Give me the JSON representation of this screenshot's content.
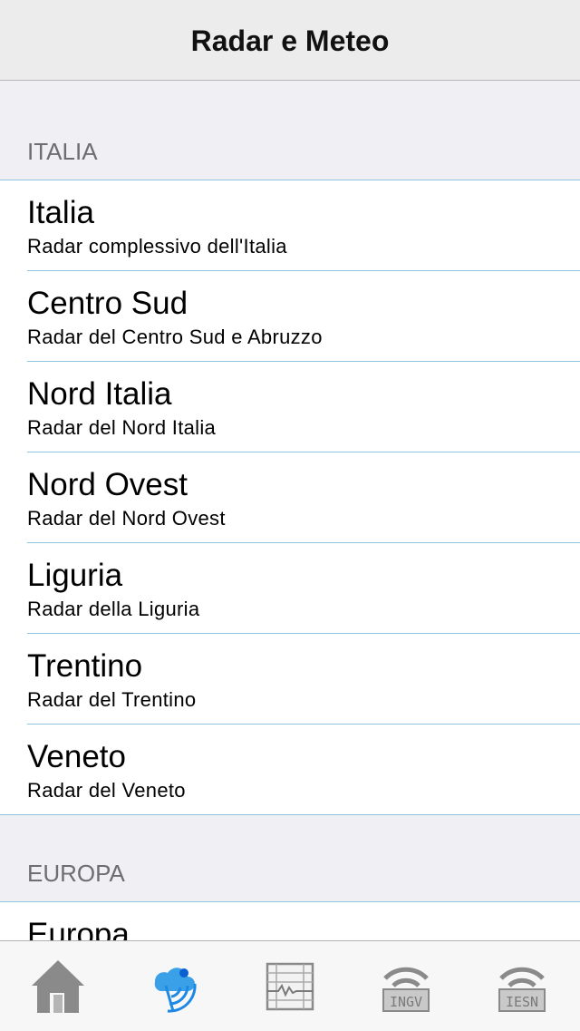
{
  "navbar": {
    "title": "Radar e Meteo"
  },
  "sections": [
    {
      "header": "ITALIA",
      "items": [
        {
          "name": "Italia",
          "subtitle": "Radar complessivo dell'Italia"
        },
        {
          "name": "Centro Sud",
          "subtitle": "Radar del Centro Sud e Abruzzo"
        },
        {
          "name": "Nord Italia",
          "subtitle": "Radar del Nord Italia"
        },
        {
          "name": "Nord Ovest",
          "subtitle": "Radar del Nord Ovest"
        },
        {
          "name": "Liguria",
          "subtitle": "Radar della Liguria"
        },
        {
          "name": "Trentino",
          "subtitle": "Radar del Trentino"
        },
        {
          "name": "Veneto",
          "subtitle": "Radar del Veneto"
        }
      ]
    },
    {
      "header": "EUROPA",
      "items": [
        {
          "name": "Europa"
        }
      ]
    }
  ],
  "tabbar": {
    "tabs": [
      {
        "icon": "home-icon",
        "selected": false
      },
      {
        "icon": "radar-icon",
        "selected": true
      },
      {
        "icon": "seismograph-icon",
        "selected": false
      },
      {
        "icon": "ingv-icon",
        "label": "INGV",
        "selected": false
      },
      {
        "icon": "iesn-icon",
        "label": "IESN",
        "selected": false
      }
    ]
  },
  "colors": {
    "accent": "#1e88e5",
    "separator": "#8fc4dc",
    "inactive": "#8e8e8e"
  }
}
